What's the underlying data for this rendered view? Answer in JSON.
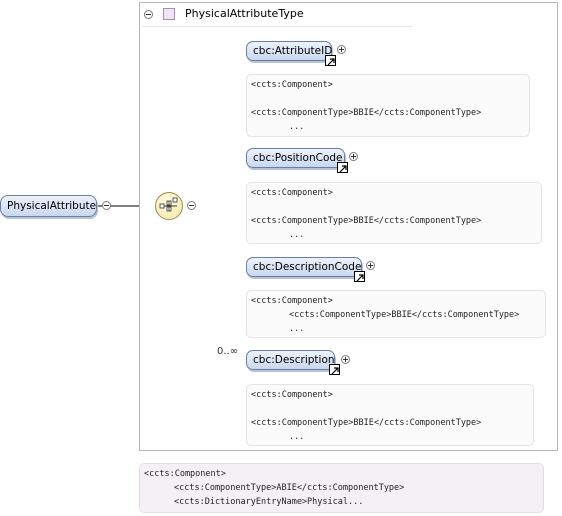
{
  "complex_type": {
    "name": "PhysicalAttributeType"
  },
  "root_element": {
    "name": "PhysicalAttribute"
  },
  "compositor": {
    "icon": "sequence-icon"
  },
  "children": [
    {
      "name": "cbc:AttributeID",
      "cardinality": "",
      "annotation": [
        "<ccts:Component>",
        "",
        "<ccts:ComponentType>BBIE</ccts:ComponentType>",
        "..."
      ]
    },
    {
      "name": "cbc:PositionCode",
      "cardinality": "",
      "annotation": [
        "<ccts:Component>",
        "",
        "<ccts:ComponentType>BBIE</ccts:ComponentType>",
        "..."
      ]
    },
    {
      "name": "cbc:DescriptionCode",
      "cardinality": "",
      "annotation": [
        "<ccts:Component>",
        "<ccts:ComponentType>BBIE</ccts:ComponentType>",
        "..."
      ]
    },
    {
      "name": "cbc:Description",
      "cardinality": "0..∞",
      "annotation": [
        "<ccts:Component>",
        "",
        "<ccts:ComponentType>BBIE</ccts:ComponentType>",
        "..."
      ]
    }
  ],
  "type_annotation": [
    "<ccts:Component>",
    "<ccts:ComponentType>ABIE</ccts:ComponentType>",
    "<ccts:DictionaryEntryName>Physical..."
  ]
}
